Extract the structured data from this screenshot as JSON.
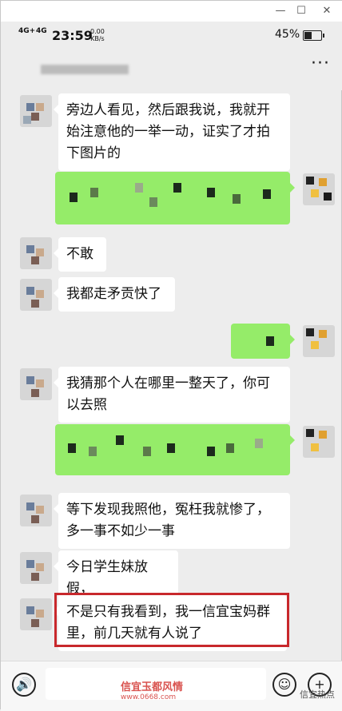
{
  "window": {
    "minimize": "—",
    "maximize": "☐",
    "close": "✕"
  },
  "status": {
    "sig1": "4G+",
    "sig2": "4G",
    "time": "23:59",
    "speed_value": "0.00",
    "speed_unit": "KB/s",
    "battery_pct": "45%",
    "battery_level": 0.45
  },
  "header": {
    "more_label": "···"
  },
  "messages": [
    {
      "side": "left",
      "text": "旁边人看见，然后跟我说，我就开始注意他的一举一动，证实了才拍下图片的"
    },
    {
      "side": "right",
      "text": ""
    },
    {
      "side": "left",
      "text": "不敢"
    },
    {
      "side": "left",
      "text": "我都走矛贡快了"
    },
    {
      "side": "right",
      "text": ""
    },
    {
      "side": "left",
      "text": "我猜那个人在哪里一整天了，你可以去照"
    },
    {
      "side": "right",
      "text": ""
    },
    {
      "side": "left",
      "text": "等下发现我照他，冤枉我就惨了，多一事不如少一事"
    },
    {
      "side": "left",
      "text": "今日学生妹放假，"
    },
    {
      "side": "left",
      "text": "不是只有我看到，我一信宜宝妈群里，前几天就有人说了"
    }
  ],
  "highlight_color": "#c8282c",
  "input": {
    "voice_icon": "🔊",
    "emoji_icon": "☺",
    "plus_icon": "+"
  },
  "watermarks": {
    "center": "信宜玉都风情",
    "center_sub": "www.0668.com",
    "corner": "信宜热点"
  }
}
